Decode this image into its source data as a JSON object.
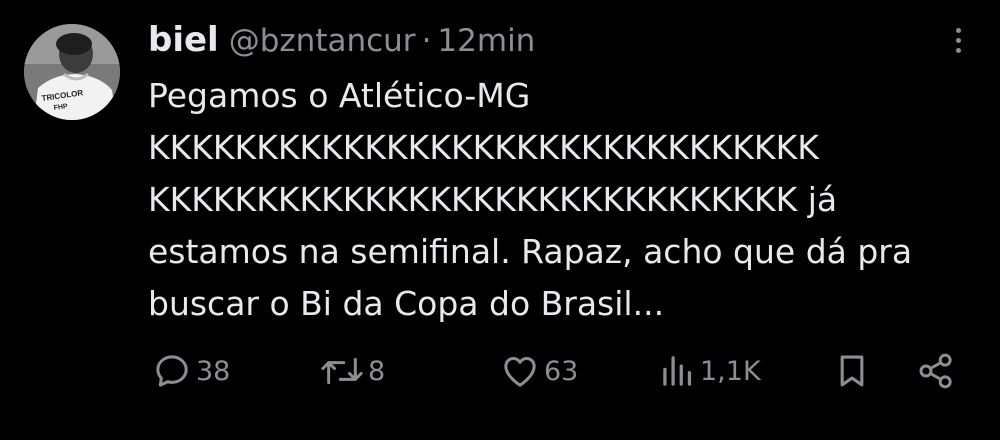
{
  "tweet": {
    "display_name": "biel",
    "handle": "@bzntancur",
    "separator": "·",
    "time": "12min",
    "text_lines": [
      "Pegamos o Atlético-MG",
      "KKKKKKKKKKKKKKKKKKKKKKKKKKKKKKK",
      "KKKKKKKKKKKKKKKKKKKKKKKKKKKKKK já",
      "estamos na semifinal. Rapaz, acho que dá pra",
      "buscar o Bi da Copa do Brasil..."
    ]
  },
  "avatar": {
    "shirt_text_1": "TRICOLOR",
    "shirt_text_2": "FHP"
  },
  "actions": {
    "replies": "38",
    "retweets": "8",
    "likes": "63",
    "views": "1,1K"
  },
  "icons": {
    "reply": "speech-bubble-icon",
    "retweet": "retweet-arrows-icon",
    "like": "heart-icon",
    "views": "bar-chart-icon",
    "bookmark": "bookmark-icon",
    "share": "share-nodes-icon",
    "more": "vertical-ellipsis-icon"
  },
  "colors": {
    "background": "#000000",
    "primary_text": "#e7e9ea",
    "secondary_text": "#8b8f94"
  }
}
